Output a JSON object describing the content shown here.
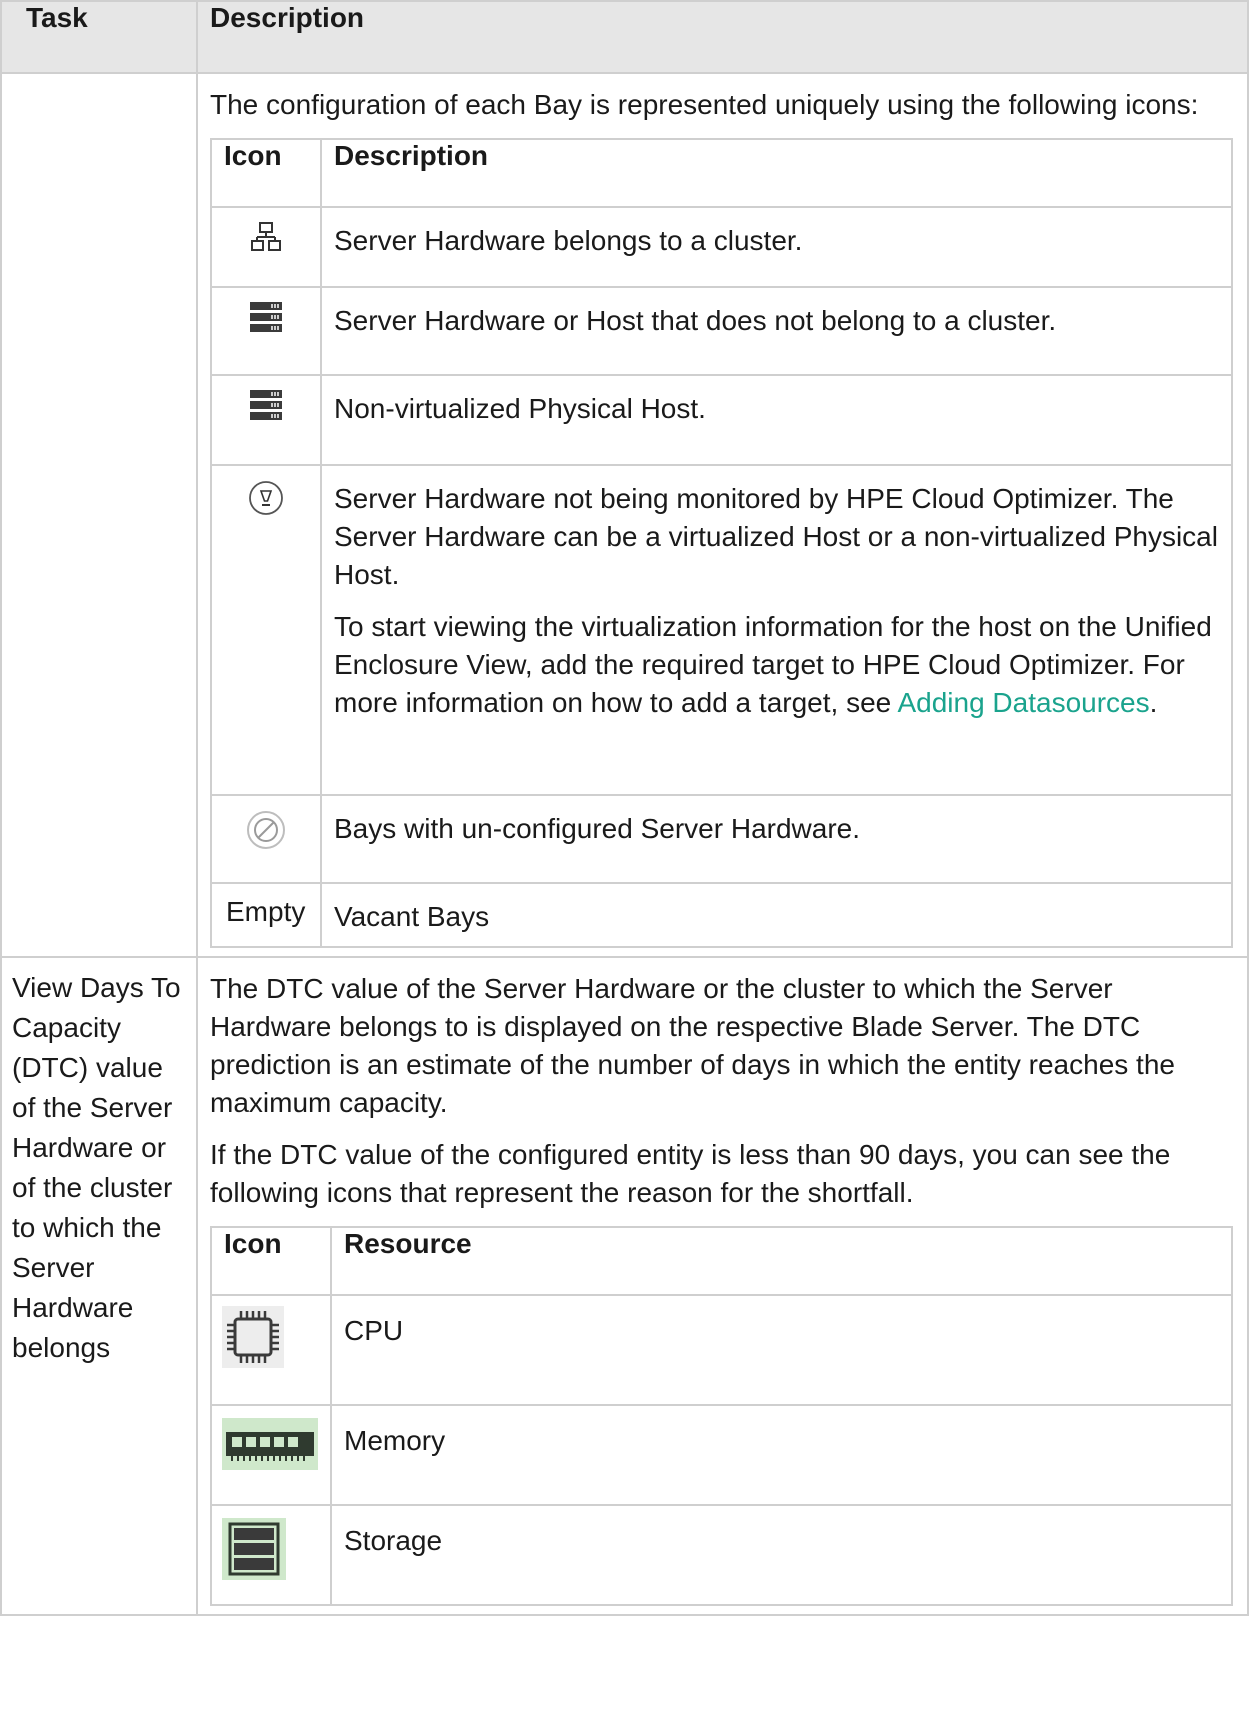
{
  "header": {
    "task": "Task",
    "description": "Description"
  },
  "row1": {
    "intro": "The configuration of each Bay is represented uniquely using the following icons:",
    "table": {
      "col_icon": "Icon",
      "col_desc": "Description",
      "rows": [
        {
          "icon": "cluster-icon",
          "desc": "Server Hardware belongs to a cluster."
        },
        {
          "icon": "server-stack-icon",
          "desc": "Server Hardware or Host that does not belong to a cluster."
        },
        {
          "icon": "server-stack-icon",
          "desc": "Non-virtualized Physical Host."
        },
        {
          "icon": "warning-circle-icon",
          "desc": "Server Hardware not being monitored by HPE Cloud Optimizer. The Server Hardware can be a virtualized Host or a non-virtualized Physical Host.",
          "desc2_pre": "To start viewing the virtualization information for the host on the Unified Enclosure View, add the required target to HPE Cloud Optimizer. For more information on how to add a target, see ",
          "desc2_link": "Adding Datasources",
          "desc2_post": "."
        },
        {
          "icon": "prohibited-icon",
          "desc": "Bays with un-configured Server Hardware."
        },
        {
          "icon_text": "Empty",
          "desc": "Vacant Bays"
        }
      ]
    }
  },
  "row2": {
    "task": "View Days To Capacity (DTC) value of the Server Hardware or of the cluster to which the Server Hardware belongs",
    "p1": "The DTC value of the Server Hardware or the cluster to which the Server Hardware belongs to is displayed on the respective Blade Server. The DTC prediction is an estimate of the number of days in which the entity reaches the maximum capacity.",
    "p2": "If the DTC value of the configured entity is less than 90 days, you can see the following icons that represent the reason for the shortfall.",
    "table": {
      "col_icon": "Icon",
      "col_res": "Resource",
      "rows": [
        {
          "icon": "cpu-chip-icon",
          "res": "CPU"
        },
        {
          "icon": "memory-module-icon",
          "res": "Memory"
        },
        {
          "icon": "storage-icon",
          "res": "Storage"
        }
      ]
    }
  },
  "colors": {
    "link": "#1aa38d",
    "header_bg": "#e6e6e6",
    "border": "#cfcfcf"
  }
}
